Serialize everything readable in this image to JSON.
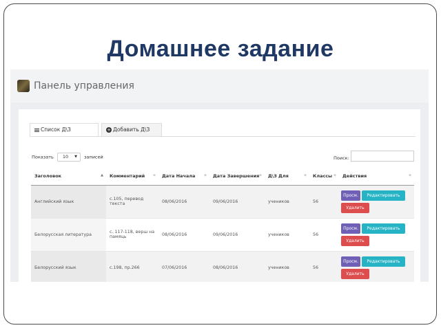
{
  "slide": {
    "title": "Домашнее задание"
  },
  "header": {
    "panel_title": "Панель управления",
    "logo_icon": "avatar-logo"
  },
  "tabs": [
    {
      "label": "Список Д\\З",
      "icon": "list-icon",
      "active": true
    },
    {
      "label": "Добавить Д\\З",
      "icon": "plus-circle-icon",
      "active": false
    }
  ],
  "length_control": {
    "prefix": "Показать",
    "value": "10",
    "suffix": "записей"
  },
  "search": {
    "label": "Поиск:",
    "value": ""
  },
  "table": {
    "columns": [
      "Заголовок",
      "Комментарий",
      "Дата Начала",
      "Дата Завершения",
      "Д\\З Для",
      "Классы",
      "Действия"
    ],
    "sorted_column": "Заголовок",
    "rows": [
      {
        "title": "Английский язык",
        "comment": "с.105, перевод текста",
        "start": "08/06/2016",
        "end": "09/06/2016",
        "for": "учеников",
        "classes": "56"
      },
      {
        "title": "Белорусская литература",
        "comment": "с. 117-118, верш на памяць",
        "start": "08/06/2016",
        "end": "09/06/2016",
        "for": "учеников",
        "classes": "56"
      },
      {
        "title": "Белорусский язык",
        "comment": "с.198, пр.266",
        "start": "07/06/2016",
        "end": "08/06/2016",
        "for": "учеников",
        "classes": "56"
      }
    ],
    "buttons": {
      "view": "Просм.",
      "edit": "Редактировать",
      "delete": "Удалить"
    }
  },
  "colors": {
    "title": "#1f3864",
    "view_button": "#6f5fb5",
    "edit_button": "#27b3c6",
    "delete_button": "#de4d4d"
  }
}
